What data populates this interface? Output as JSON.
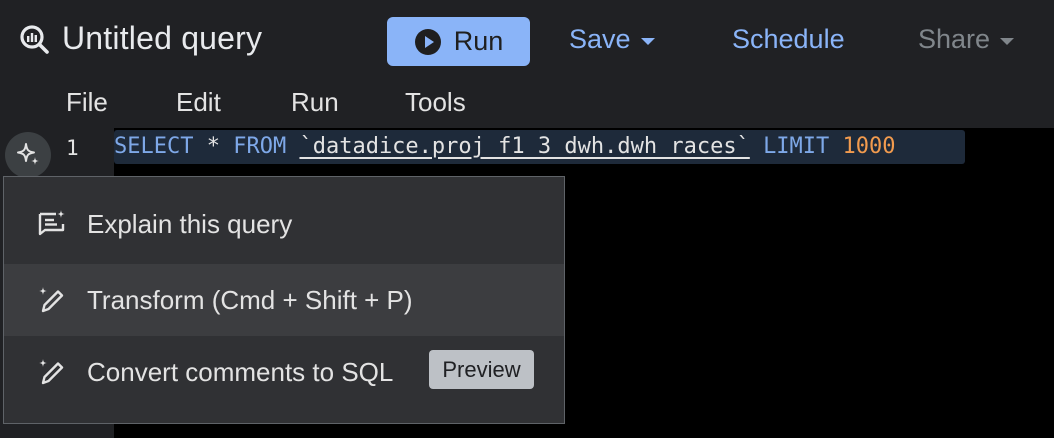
{
  "header": {
    "title": "Untitled query",
    "title_icon": "bigquery-search-icon",
    "run_label": "Run",
    "save_label": "Save",
    "schedule_label": "Schedule",
    "share_label": "Share"
  },
  "menubar": {
    "items": [
      {
        "label": "File"
      },
      {
        "label": "Edit"
      },
      {
        "label": "Run"
      },
      {
        "label": "Tools"
      }
    ]
  },
  "editor": {
    "line_number": "1",
    "code": {
      "select": "SELECT",
      "star": "*",
      "from": "FROM",
      "table": "`datadice.proj_f1_3_dwh.dwh_races`",
      "limit": "LIMIT",
      "limit_value": "1000"
    }
  },
  "gemini_menu": {
    "items": [
      {
        "label": "Explain this query",
        "icon": "explain-notes-icon"
      },
      {
        "label": "Transform (Cmd + Shift + P)",
        "icon": "magic-pen-icon"
      },
      {
        "label": "Convert comments to SQL",
        "icon": "magic-pen-icon",
        "badge": "Preview"
      }
    ]
  },
  "colors": {
    "accent": "#8ab4f8",
    "keyword": "#7ea8e8",
    "number": "#f29b4e",
    "panel": "#202124",
    "menu": "#303134"
  }
}
